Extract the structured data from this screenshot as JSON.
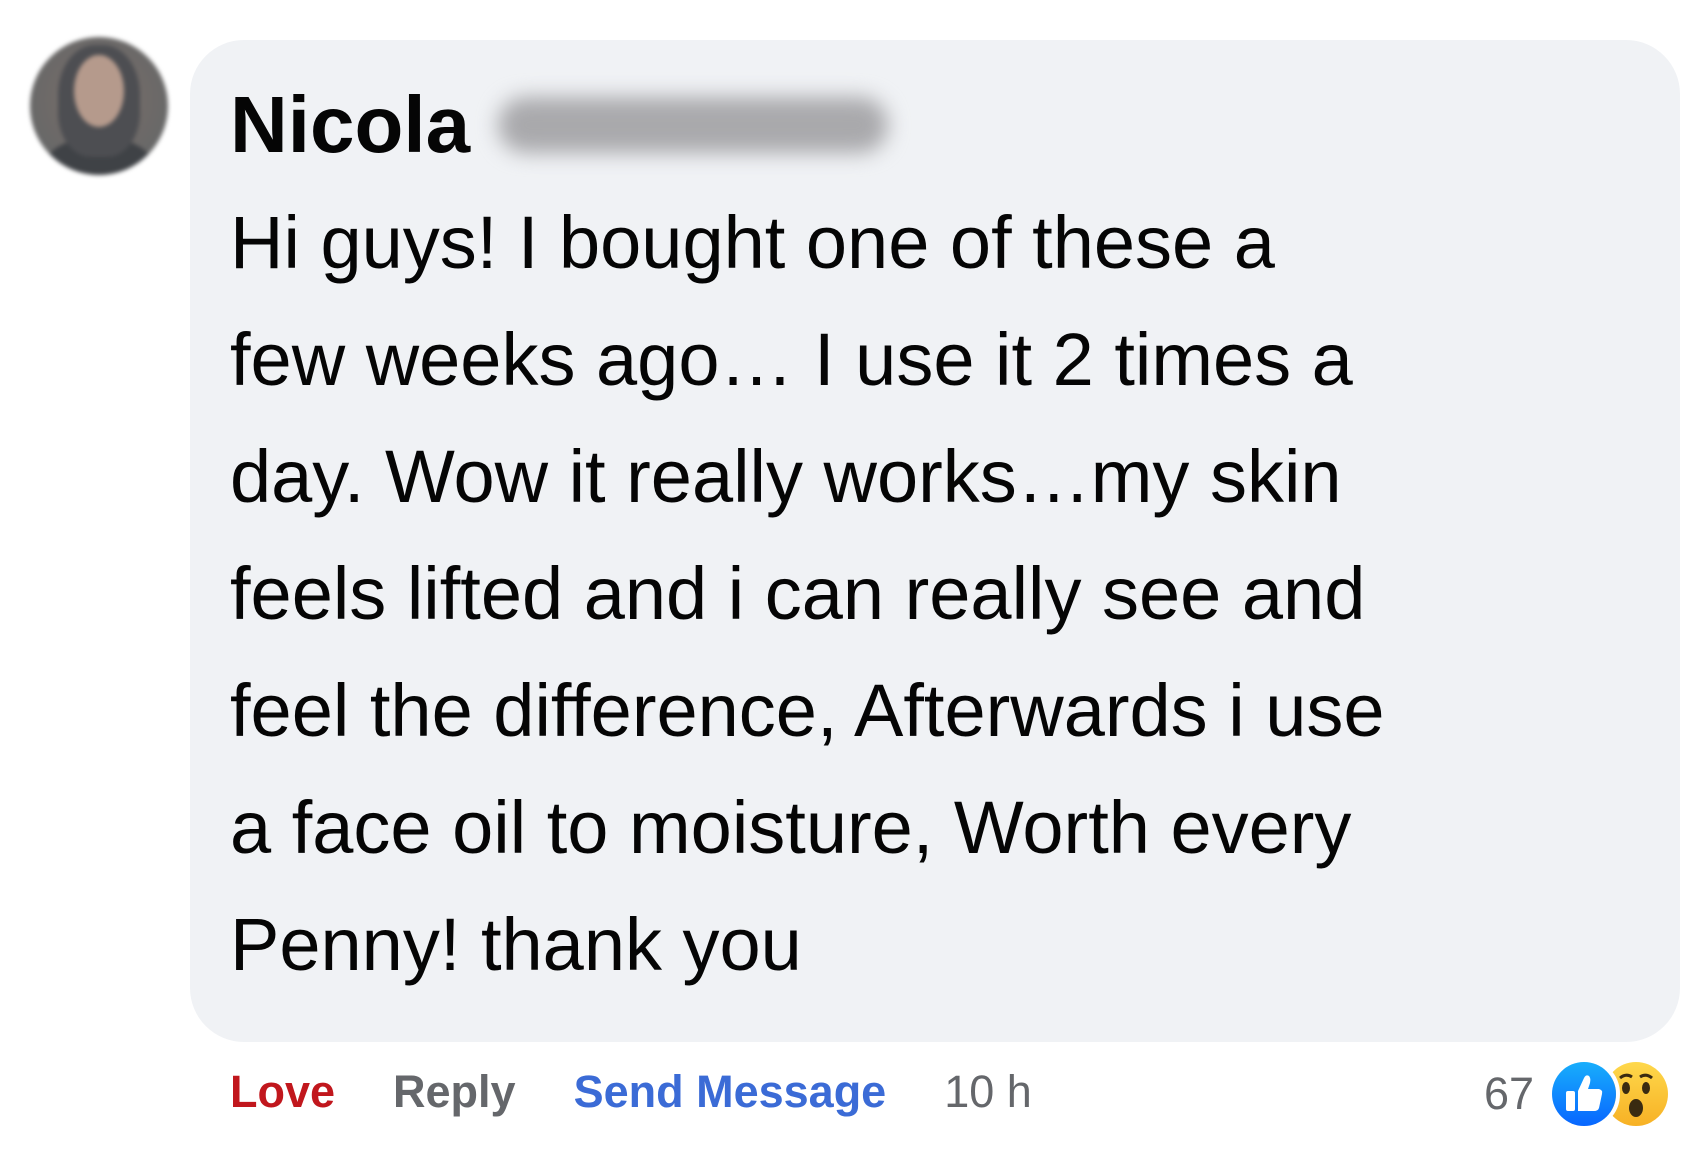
{
  "comment": {
    "author_name": "Nicola",
    "author_surname_redacted": "",
    "text": "Hi guys! I bought one of these a\nfew weeks ago… I use it 2 times a\nday. Wow it really works…my skin\nfeels lifted and i can really see and\nfeel the difference, Afterwards i use\na face oil to moisture, Worth every\nPenny! thank you"
  },
  "actions": {
    "love_label": "Love",
    "reply_label": "Reply",
    "send_message_label": "Send Message",
    "timestamp": "10 h"
  },
  "reactions": {
    "count": "67",
    "icons": [
      "like-icon",
      "wow-icon"
    ]
  },
  "colors": {
    "bubble_bg": "#f0f2f5",
    "love": "#c1171d",
    "reply": "#65676b",
    "send_message": "#3b6bd6",
    "like_blue": "#1877f2",
    "wow_yellow": "#f7b125"
  }
}
